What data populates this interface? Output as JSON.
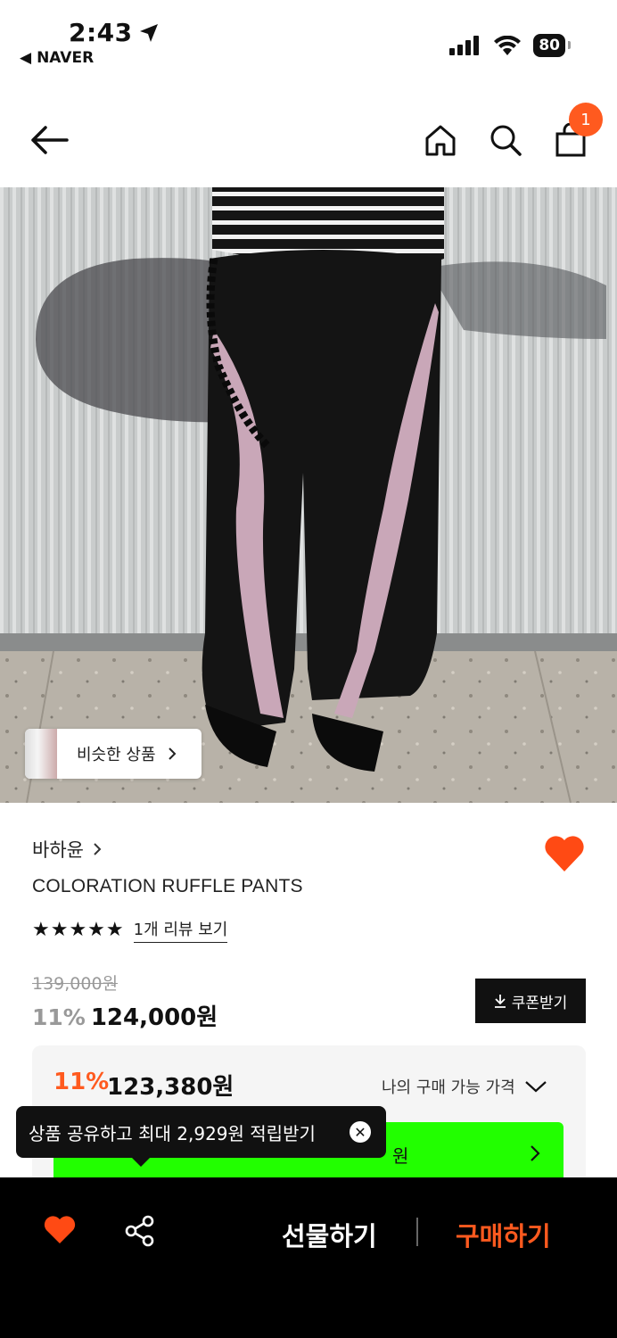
{
  "status_bar": {
    "time": "2:43",
    "back_app": "NAVER",
    "battery": "80"
  },
  "header": {
    "cart_count": "1"
  },
  "product": {
    "similar_label": "비슷한 상품",
    "brand": "바하윤",
    "name": "COLORATION RUFFLE PANTS",
    "stars": "★★★★★",
    "review_link": "1개 리뷰 보기",
    "original_price": "139,000원",
    "discount_pct": "11%",
    "sale_price": "124,000원",
    "coupon_label": "쿠폰받기"
  },
  "my_price": {
    "discount_pct": "11%",
    "price": "123,380원",
    "label": "나의 구매 가능 가격",
    "banner_text": "원"
  },
  "tooltip": {
    "text": "상품 공유하고 최대 2,929원 적립받기"
  },
  "bottom_bar": {
    "gift_label": "선물하기",
    "buy_label": "구매하기"
  },
  "colors": {
    "accent": "#ff5a1f",
    "banner_green": "#22ff00"
  }
}
